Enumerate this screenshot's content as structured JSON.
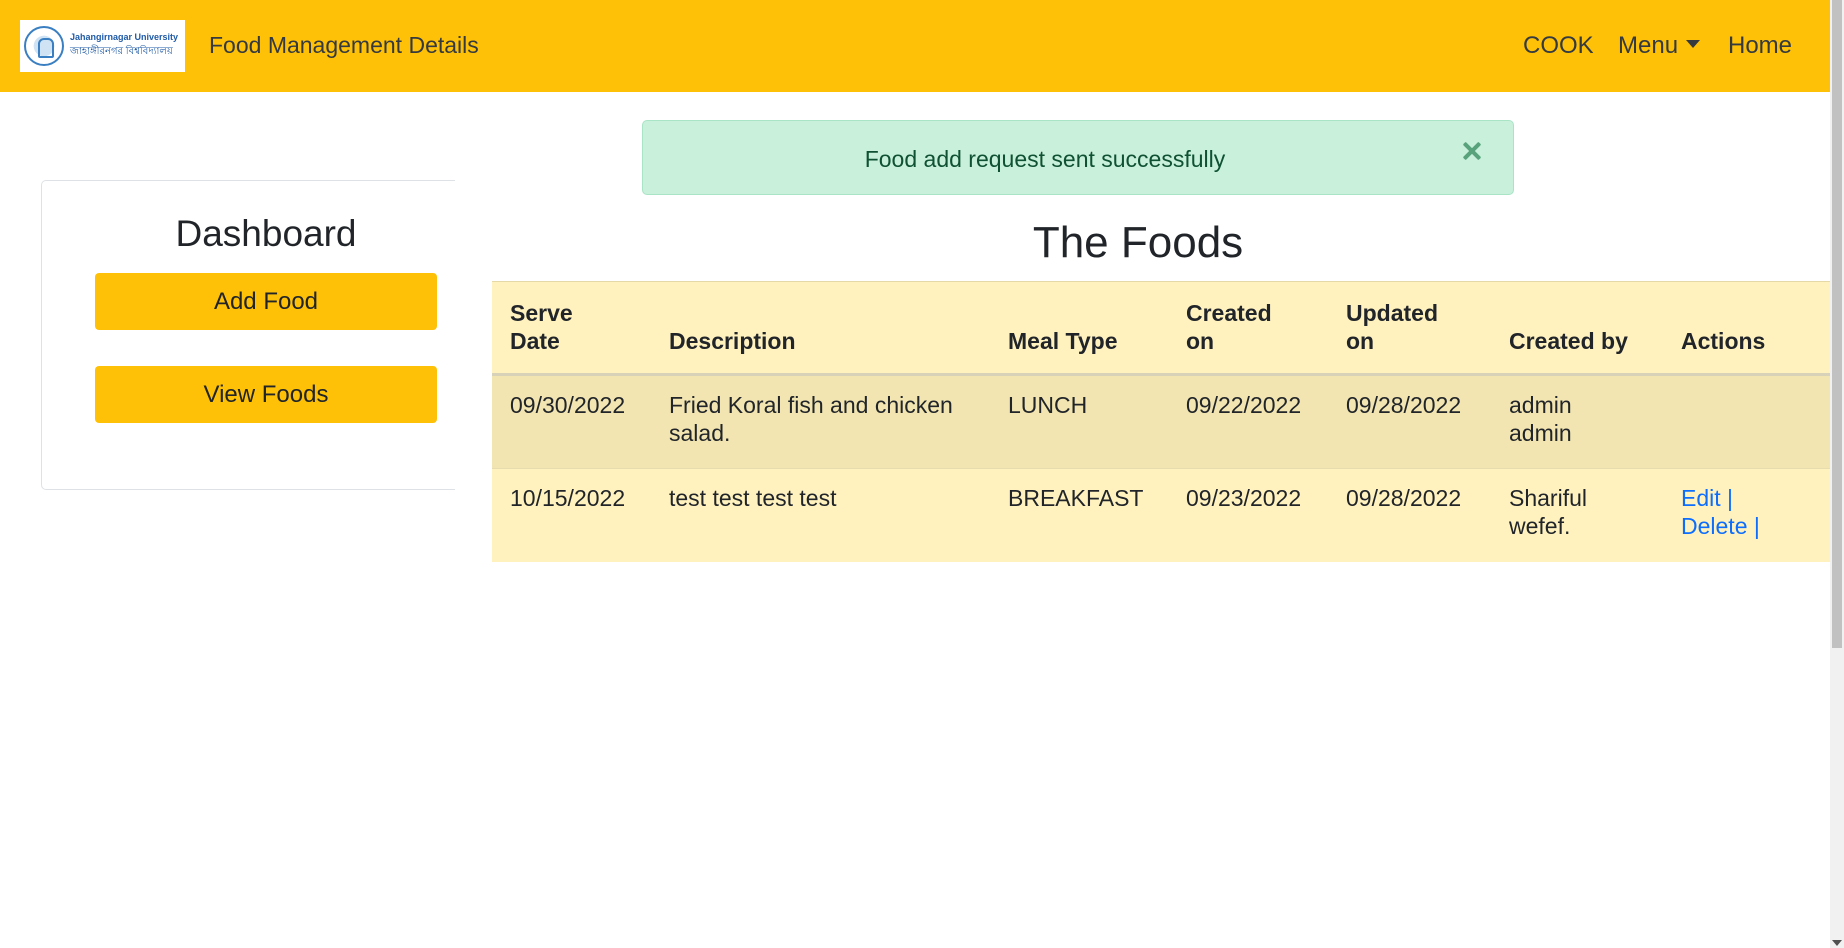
{
  "navbar": {
    "logo_line1": "Jahangirnagar University",
    "logo_line2": "জাহাঙ্গীরনগর বিশ্ববিদ্যালয়",
    "brand": "Food Management Details",
    "links": {
      "cook": "COOK",
      "menu": "Menu",
      "home": "Home"
    }
  },
  "sidebar": {
    "title": "Dashboard",
    "add_food": "Add Food",
    "view_foods": "View Foods"
  },
  "alert": {
    "message": "Food add request sent successfully"
  },
  "main": {
    "title": "The Foods",
    "table": {
      "headers": {
        "serve_date_1": "Serve",
        "serve_date_2": "Date",
        "description": "Description",
        "meal_type": "Meal Type",
        "created_1": "Created",
        "created_2": "on",
        "updated_1": "Updated",
        "updated_2": "on",
        "created_by": "Created by",
        "actions": "Actions"
      },
      "rows": [
        {
          "serve_date": "09/30/2022",
          "description": "Fried Koral fish and chicken salad.",
          "meal_type": "LUNCH",
          "created_on": "09/22/2022",
          "updated_on": "09/28/2022",
          "created_by": "admin admin"
        },
        {
          "serve_date": "10/15/2022",
          "description": "test test test test",
          "meal_type": "BREAKFAST",
          "created_on": "09/23/2022",
          "updated_on": "09/28/2022",
          "created_by": "Shariful wefef.",
          "edit": "Edit |",
          "delete": "Delete |"
        }
      ]
    }
  },
  "colors": {
    "navbar": "#ffc107",
    "alert_bg": "#c8f0db",
    "alert_text": "#0f5132",
    "table_row": "#fff2bf",
    "table_row_alt": "#f2e5b1",
    "link": "#0d6efd"
  }
}
